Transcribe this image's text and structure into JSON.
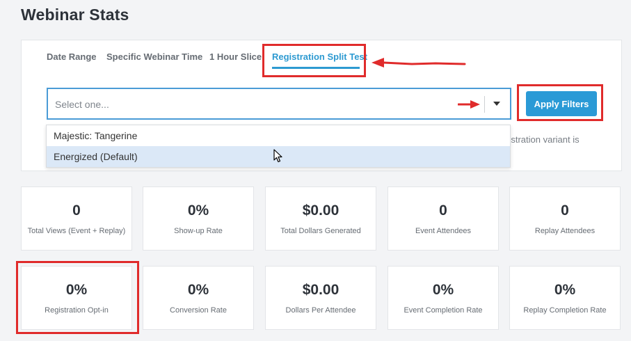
{
  "page": {
    "title": "Webinar Stats"
  },
  "tabs": [
    {
      "label": "Date Range",
      "active": false
    },
    {
      "label": "Specific Webinar Time",
      "active": false
    },
    {
      "label": "1 Hour Slice",
      "active": false
    },
    {
      "label": "Registration Split Test",
      "active": true
    }
  ],
  "filter": {
    "placeholder": "Select one...",
    "apply_label": "Apply Filters",
    "helper_text": "egistration variant is",
    "options": [
      {
        "label": "Majestic: Tangerine",
        "highlighted": false
      },
      {
        "label": "Energized (Default)",
        "highlighted": true
      }
    ]
  },
  "stats_row1": [
    {
      "value": "0",
      "label": "Total Views (Event + Replay)"
    },
    {
      "value": "0%",
      "label": "Show-up Rate"
    },
    {
      "value": "$0.00",
      "label": "Total Dollars Generated"
    },
    {
      "value": "0",
      "label": "Event Attendees"
    },
    {
      "value": "0",
      "label": "Replay Attendees"
    }
  ],
  "stats_row2": [
    {
      "value": "0%",
      "label": "Registration Opt-in"
    },
    {
      "value": "0%",
      "label": "Conversion Rate"
    },
    {
      "value": "$0.00",
      "label": "Dollars Per Attendee"
    },
    {
      "value": "0%",
      "label": "Event Completion Rate"
    },
    {
      "value": "0%",
      "label": "Replay Completion Rate"
    }
  ],
  "colors": {
    "accent": "#2d9ad1",
    "annotation": "#e02b2b",
    "dropdown_highlight": "#dbe8f7"
  },
  "icons": [
    "chevron-down-icon",
    "mouse-pointer-icon",
    "annotation-arrow-icon"
  ]
}
